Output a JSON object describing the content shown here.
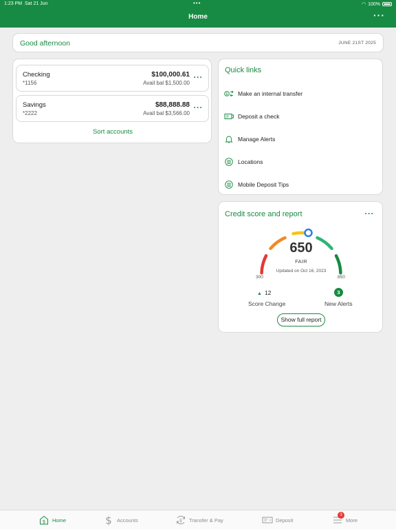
{
  "status_bar": {
    "time": "1:23 PM",
    "date": "Sat 21 Jun",
    "battery": "100%"
  },
  "header": {
    "title": "Home",
    "more_icon": "ellipsis-icon"
  },
  "greeting": {
    "text": "Good afternoon",
    "date": "JUNE 21ST 2025"
  },
  "accounts": {
    "items": [
      {
        "name": "Checking",
        "number": "*1156",
        "balance": "$100,000.61",
        "available": "Avail bal $1,500.00"
      },
      {
        "name": "Savings",
        "number": "*2222",
        "balance": "$88,888.88",
        "available": "Avail bal $3,566.00"
      }
    ],
    "sort_label": "Sort accounts"
  },
  "quick_links": {
    "title": "Quick links",
    "items": [
      {
        "label": "Make an internal transfer",
        "icon": "transfer-icon"
      },
      {
        "label": "Deposit a check",
        "icon": "check-deposit-icon"
      },
      {
        "label": "Manage Alerts",
        "icon": "bell-icon"
      },
      {
        "label": "Locations",
        "icon": "bank-icon"
      },
      {
        "label": "Mobile Deposit Tips",
        "icon": "bank-icon"
      }
    ]
  },
  "credit": {
    "title": "Credit score and report",
    "score": "650",
    "band": "FAIR",
    "updated": "Updated on Oct 16, 2023",
    "min": "300",
    "max": "850",
    "score_change": "12",
    "score_change_label": "Score Change",
    "new_alerts": "3",
    "new_alerts_label": "New Alerts",
    "report_button": "Show full report",
    "colors": {
      "red": "#e53935",
      "orange": "#f08a24",
      "yellow": "#f5c518",
      "green": "#2bb673",
      "dark_green": "#178a43",
      "marker": "#2f7de1"
    }
  },
  "tabbar": {
    "items": [
      {
        "label": "Home",
        "icon": "home-icon",
        "active": true
      },
      {
        "label": "Accounts",
        "icon": "dollar-icon"
      },
      {
        "label": "Transfer & Pay",
        "icon": "transfer-pay-icon"
      },
      {
        "label": "Deposit",
        "icon": "deposit-icon"
      },
      {
        "label": "More",
        "icon": "menu-icon",
        "badge": "3"
      }
    ]
  },
  "colors": {
    "brand": "#178a43",
    "background": "#eeeeee"
  }
}
